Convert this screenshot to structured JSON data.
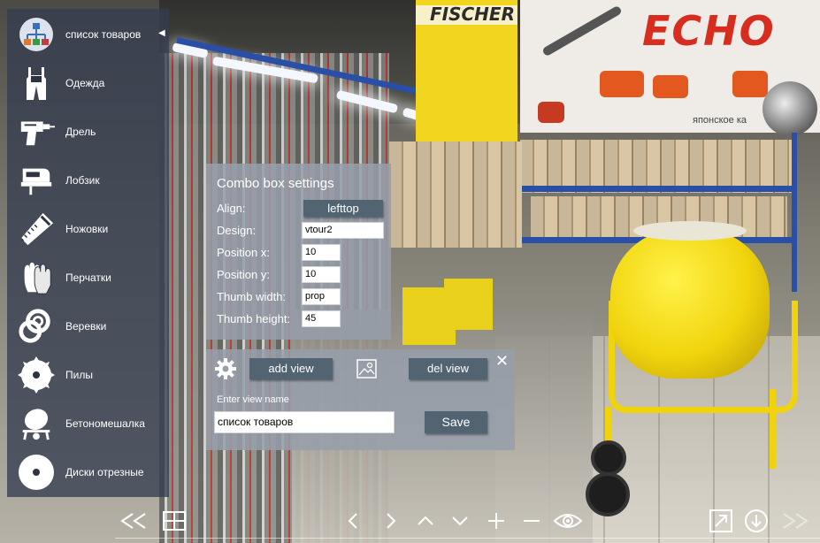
{
  "menu": {
    "items": [
      {
        "label": "список товаров",
        "icon": "sitemap-icon",
        "active": true
      },
      {
        "label": "Одежда",
        "icon": "overalls-icon"
      },
      {
        "label": "Дрель",
        "icon": "drill-icon"
      },
      {
        "label": "Лобзик",
        "icon": "jigsaw-icon"
      },
      {
        "label": "Ножовки",
        "icon": "handsaw-icon"
      },
      {
        "label": "Перчатки",
        "icon": "gloves-icon"
      },
      {
        "label": "Веревки",
        "icon": "rope-icon"
      },
      {
        "label": "Пилы",
        "icon": "saw-blade-icon"
      },
      {
        "label": "Бетономешалка",
        "icon": "concrete-mixer-icon"
      },
      {
        "label": "Диски отрезные",
        "icon": "cutting-disc-icon"
      }
    ],
    "active_marker": "◀"
  },
  "combo": {
    "title": "Combo box settings",
    "align_label": "Align:",
    "align_value": "lefttop",
    "design_label": "Design:",
    "design_value": "vtour2",
    "posx_label": "Position x:",
    "posx_value": "10",
    "posy_label": "Position y:",
    "posy_value": "10",
    "thumbw_label": "Thumb width:",
    "thumbw_value": "prop",
    "thumbh_label": "Thumb height:",
    "thumbh_value": "45"
  },
  "view": {
    "add_label": "add view",
    "del_label": "del view",
    "caption": "Enter view name",
    "name_value": "список товаров",
    "save_label": "Save",
    "close_glyph": "✕"
  },
  "background": {
    "brand_left": "FISCHER",
    "brand_right": "ECHO",
    "banner_text": "японское ка"
  },
  "colors": {
    "panel": "#969eaa",
    "button": "#526372",
    "menu": "#343e50",
    "accent_yellow": "#f1d40d",
    "echo_red": "#d62d1e"
  },
  "toolbar": {
    "icons": [
      "rewind-icon",
      "thumbnails-grid-icon",
      "arrow-left-icon",
      "arrow-right-icon",
      "arrow-up-icon",
      "arrow-down-icon",
      "zoom-in-icon",
      "zoom-out-icon",
      "eye-icon",
      "fullscreen-icon",
      "download-icon",
      "fast-forward-icon"
    ]
  }
}
